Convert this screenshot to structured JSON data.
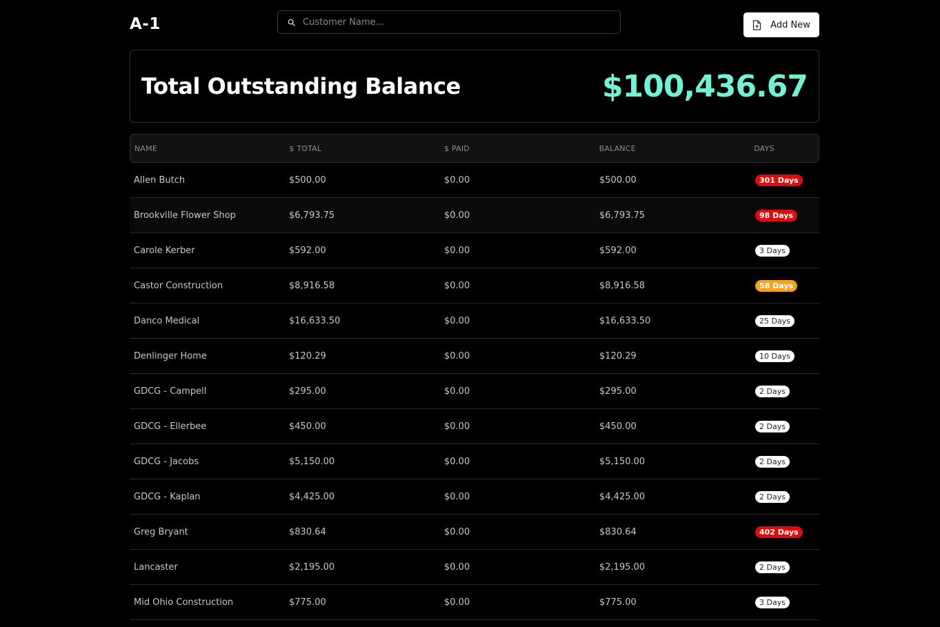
{
  "header": {
    "logo": "A-1",
    "search_placeholder": "Customer Name...",
    "search_value": "",
    "add_button_label": "Add New"
  },
  "balance": {
    "title": "Total Outstanding Balance",
    "value": "$100,436.67"
  },
  "colors": {
    "accent_teal": "#72f2d4",
    "badge_red": "#e00b0b",
    "badge_orange": "#f4a321",
    "badge_white": "#ffffff"
  },
  "table": {
    "columns": [
      "NAME",
      "$ TOTAL",
      "$ PAID",
      "BALANCE",
      "DAYS"
    ],
    "rows": [
      {
        "name": "Allen Butch",
        "total": "$500.00",
        "paid": "$0.00",
        "balance": "$500.00",
        "days": "301 Days",
        "status": "red"
      },
      {
        "name": "Brookville Flower Shop",
        "total": "$6,793.75",
        "paid": "$0.00",
        "balance": "$6,793.75",
        "days": "98 Days",
        "status": "red"
      },
      {
        "name": "Carole Kerber",
        "total": "$592.00",
        "paid": "$0.00",
        "balance": "$592.00",
        "days": "3 Days",
        "status": "white"
      },
      {
        "name": "Castor Construction",
        "total": "$8,916.58",
        "paid": "$0.00",
        "balance": "$8,916.58",
        "days": "58 Days",
        "status": "orange"
      },
      {
        "name": "Danco Medical",
        "total": "$16,633.50",
        "paid": "$0.00",
        "balance": "$16,633.50",
        "days": "25 Days",
        "status": "white"
      },
      {
        "name": "Denlinger Home",
        "total": "$120.29",
        "paid": "$0.00",
        "balance": "$120.29",
        "days": "10 Days",
        "status": "white"
      },
      {
        "name": "GDCG - Campell",
        "total": "$295.00",
        "paid": "$0.00",
        "balance": "$295.00",
        "days": "2 Days",
        "status": "white"
      },
      {
        "name": "GDCG - Ellerbee",
        "total": "$450.00",
        "paid": "$0.00",
        "balance": "$450.00",
        "days": "2 Days",
        "status": "white"
      },
      {
        "name": "GDCG - Jacobs",
        "total": "$5,150.00",
        "paid": "$0.00",
        "balance": "$5,150.00",
        "days": "2 Days",
        "status": "white"
      },
      {
        "name": "GDCG - Kaplan",
        "total": "$4,425.00",
        "paid": "$0.00",
        "balance": "$4,425.00",
        "days": "2 Days",
        "status": "white"
      },
      {
        "name": "Greg Bryant",
        "total": "$830.64",
        "paid": "$0.00",
        "balance": "$830.64",
        "days": "402 Days",
        "status": "red"
      },
      {
        "name": "Lancaster",
        "total": "$2,195.00",
        "paid": "$0.00",
        "balance": "$2,195.00",
        "days": "2 Days",
        "status": "white"
      },
      {
        "name": "Mid Ohio Construction",
        "total": "$775.00",
        "paid": "$0.00",
        "balance": "$775.00",
        "days": "3 Days",
        "status": "white"
      }
    ]
  }
}
